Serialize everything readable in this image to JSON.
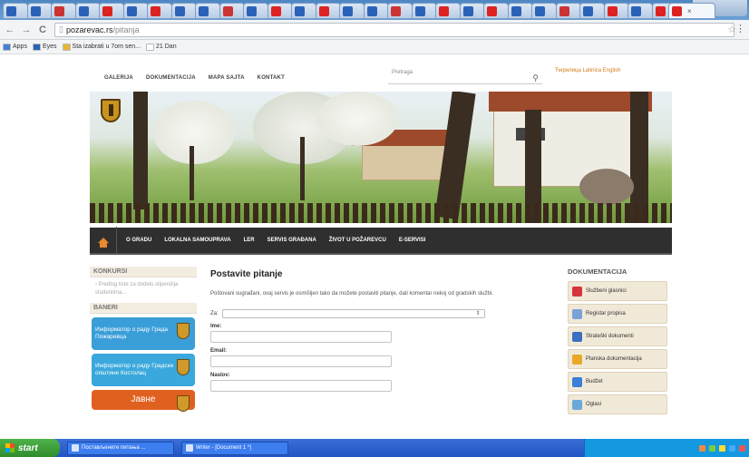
{
  "browser": {
    "tabs_count": 28,
    "active_tab_close": "×",
    "url_domain": "pozarevac.rs",
    "url_path": "/pitanja",
    "bookmarks": [
      {
        "label": "Apps",
        "color": "#4a7fd4"
      },
      {
        "label": "Eyes",
        "color": "#2a62b8"
      },
      {
        "label": "Sta izabrati u 7om sen...",
        "color": "#e7b43a"
      },
      {
        "label": "21 Dan",
        "color": "#ffffff"
      }
    ]
  },
  "site": {
    "top_nav": [
      "GALERIJA",
      "DOKUMENTACIJA",
      "MAPA SAJTA",
      "KONTAKT"
    ],
    "search_placeholder": "Pretraga",
    "languages": "Ћирилица  Latinica  English",
    "main_nav": [
      "O GRADU",
      "LOKALNA SAMOUPRAVA",
      "LER",
      "SERVIS GRAĐANA",
      "ŽIVOT U POŽAREVCU",
      "E-SERVISI"
    ],
    "left": {
      "konkursi_title": "KONKURSI",
      "konkursi_link": "› Predlog liste za dodelu stipendija studentima...",
      "baneri_title": "BANERI",
      "banners": [
        {
          "text": "Информатор о раду Града Пожаревца",
          "color": "#3a9ed8"
        },
        {
          "text": "Информатор о раду Градске општине Костолац",
          "color": "#3aa8dc"
        },
        {
          "text": "Јавне",
          "color": "#e0611f"
        }
      ]
    },
    "center": {
      "title": "Postavite pitanje",
      "description": "Poštovani sugrađani, ovaj servis je osmišljen tako da možete postaviti pitanje, dati komentar nekoj od gradskih službi.",
      "za_label": "Za:",
      "za_value": "",
      "fields": [
        "Ime:",
        "Email:",
        "Naslov:"
      ]
    },
    "right": {
      "title": "DOKUMENTACIJA",
      "items": [
        {
          "label": "Službeni glasnici",
          "icon": "flag-icon",
          "color": "#d6343b"
        },
        {
          "label": "Registar propisa",
          "icon": "person-icon",
          "color": "#7aa2d6"
        },
        {
          "label": "Strateški dokumenti",
          "icon": "folder-icon",
          "color": "#3b6fbf"
        },
        {
          "label": "Planska dokumentacija",
          "icon": "pin-icon",
          "color": "#e8a82a"
        },
        {
          "label": "Budžet",
          "icon": "chart-icon",
          "color": "#3b7fd6"
        },
        {
          "label": "Oglasi",
          "icon": "note-icon",
          "color": "#6aa8d8"
        }
      ]
    }
  },
  "taskbar": {
    "start": "start",
    "tasks": [
      "Постављените питања ...",
      "Writer - [Document 1 *]"
    ]
  }
}
